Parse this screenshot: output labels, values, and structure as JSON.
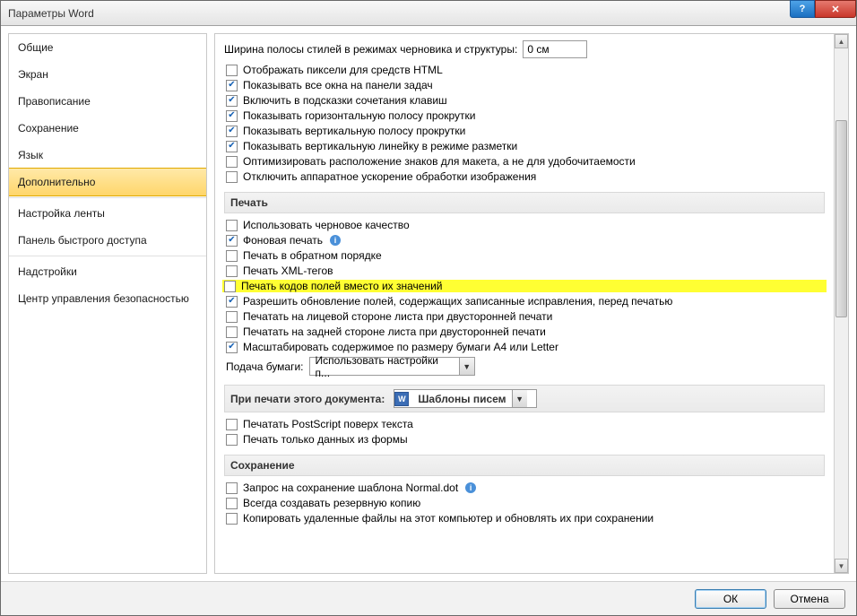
{
  "title": "Параметры Word",
  "buttons": {
    "ok": "ОК",
    "cancel": "Отмена"
  },
  "sidebar": {
    "items": [
      "Общие",
      "Экран",
      "Правописание",
      "Сохранение",
      "Язык",
      "Дополнительно",
      "Настройка ленты",
      "Панель быстрого доступа",
      "Надстройки",
      "Центр управления безопасностью"
    ],
    "selected_index": 5
  },
  "top": {
    "style_width_label": "Ширина полосы стилей в режимах черновика и структуры:",
    "style_width_value": "0 см"
  },
  "display_opts": [
    {
      "label": "Отображать пиксели для средств HTML",
      "checked": false
    },
    {
      "label": "Показывать все окна на панели задач",
      "checked": true
    },
    {
      "label": "Включить в подсказки сочетания клавиш",
      "checked": true
    },
    {
      "label": "Показывать горизонтальную полосу прокрутки",
      "checked": true
    },
    {
      "label": "Показывать вертикальную полосу прокрутки",
      "checked": true
    },
    {
      "label": "Показывать вертикальную линейку в режиме разметки",
      "checked": true
    },
    {
      "label": "Оптимизировать расположение знаков для макета, а не для удобочитаемости",
      "checked": false
    },
    {
      "label": "Отключить аппаратное ускорение обработки изображения",
      "checked": false
    }
  ],
  "sections": {
    "print": "Печать",
    "print_doc": "При печати этого документа:",
    "save": "Сохранение"
  },
  "print_opts": [
    {
      "label": "Использовать черновое качество",
      "checked": false
    },
    {
      "label": "Фоновая печать",
      "checked": true,
      "info": true
    },
    {
      "label": "Печать в обратном порядке",
      "checked": false
    },
    {
      "label": "Печать XML-тегов",
      "checked": false
    },
    {
      "label": "Печать кодов полей вместо их значений",
      "checked": false,
      "highlight": true
    },
    {
      "label": "Разрешить обновление полей, содержащих записанные исправления, перед печатью",
      "checked": true
    },
    {
      "label": "Печатать на лицевой стороне листа при двусторонней печати",
      "checked": false
    },
    {
      "label": "Печатать на задней стороне листа при двусторонней печати",
      "checked": false
    },
    {
      "label": "Масштабировать содержимое по размеру бумаги A4 или Letter",
      "checked": true
    }
  ],
  "paper_feed": {
    "label": "Подача бумаги:",
    "value": "Использовать настройки п..."
  },
  "print_doc_dropdown": "Шаблоны писем",
  "print_doc_opts": [
    {
      "label": "Печатать PostScript поверх текста",
      "checked": false
    },
    {
      "label": "Печать только данных из формы",
      "checked": false
    }
  ],
  "save_opts": [
    {
      "label": "Запрос на сохранение шаблона Normal.dot",
      "checked": false,
      "info": true
    },
    {
      "label": "Всегда создавать резервную копию",
      "checked": false
    },
    {
      "label": "Копировать удаленные файлы на этот компьютер и обновлять их при сохранении",
      "checked": false
    }
  ]
}
